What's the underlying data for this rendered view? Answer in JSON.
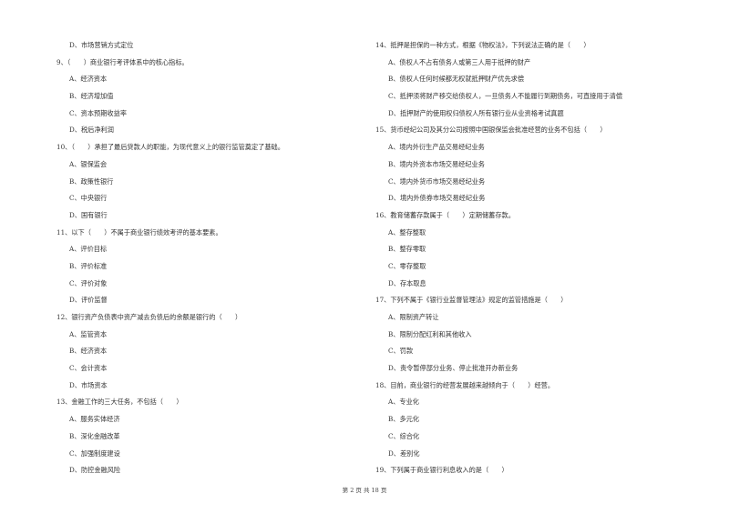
{
  "left_column": [
    {
      "type": "opt",
      "text": "D、市场营销方式定位"
    },
    {
      "type": "q",
      "text": "9、（　　）商业银行考评体系中的核心指标。"
    },
    {
      "type": "opt",
      "text": "A、经济资本"
    },
    {
      "type": "opt",
      "text": "B、经济增加值"
    },
    {
      "type": "opt",
      "text": "C、资本预期收益率"
    },
    {
      "type": "opt",
      "text": "D、税后净利润"
    },
    {
      "type": "q",
      "text": "10、（　　）承担了最后贷款人的职能，为现代意义上的银行监管奠定了基础。"
    },
    {
      "type": "opt",
      "text": "A、银保监会"
    },
    {
      "type": "opt",
      "text": "B、政策性银行"
    },
    {
      "type": "opt",
      "text": "C、中央银行"
    },
    {
      "type": "opt",
      "text": "D、国有银行"
    },
    {
      "type": "q",
      "text": "11、以下（　　）不属于商业银行绩效考评的基本要素。"
    },
    {
      "type": "opt",
      "text": "A、评价目标"
    },
    {
      "type": "opt",
      "text": "B、评价标准"
    },
    {
      "type": "opt",
      "text": "C、评价对象"
    },
    {
      "type": "opt",
      "text": "D、评价监督"
    },
    {
      "type": "q",
      "text": "12、银行资产负债表中资产减去负债后的余额是银行的（　　）"
    },
    {
      "type": "opt",
      "text": "A、监管资本"
    },
    {
      "type": "opt",
      "text": "B、经济资本"
    },
    {
      "type": "opt",
      "text": "C、会计资本"
    },
    {
      "type": "opt",
      "text": "D、市场资本"
    },
    {
      "type": "q",
      "text": "13、金融工作的三大任务，不包括（　　）"
    },
    {
      "type": "opt",
      "text": "A、服务实体经济"
    },
    {
      "type": "opt",
      "text": "B、深化金融改革"
    },
    {
      "type": "opt",
      "text": "C、加强制度建设"
    },
    {
      "type": "opt",
      "text": "D、防控金融风险"
    }
  ],
  "right_column": [
    {
      "type": "q",
      "text": "14、抵押是担保的一种方式，根据《物权法》，下列说法正确的是（　　）"
    },
    {
      "type": "opt",
      "text": "A、债权人不占有债务人或第三人用于抵押的财产"
    },
    {
      "type": "opt",
      "text": "B、债权人任何时候都无权就抵押财产优先求偿"
    },
    {
      "type": "opt",
      "text": "C、抵押须将财产移交给债权人，一旦债务人不能履行到期债务，可直接用于清偿"
    },
    {
      "type": "opt",
      "text": "D、抵押财产的使用权归债权人所有银行业从业资格考试真题"
    },
    {
      "type": "q",
      "text": "15、货币经纪公司及其分公司按照中国银保监会批准经营的业务不包括（　　）"
    },
    {
      "type": "opt",
      "text": "A、境内外衍生产品交易经纪业务"
    },
    {
      "type": "opt",
      "text": "B、境内外资本市场交易经纪业务"
    },
    {
      "type": "opt",
      "text": "C、境内外货币市场交易经纪业务"
    },
    {
      "type": "opt",
      "text": "D、境内外债券市场交易经纪业务"
    },
    {
      "type": "q",
      "text": "16、教育储蓄存款属于（　　）定期储蓄存款。"
    },
    {
      "type": "opt",
      "text": "A、整存整取"
    },
    {
      "type": "opt",
      "text": "B、整存零取"
    },
    {
      "type": "opt",
      "text": "C、零存整取"
    },
    {
      "type": "opt",
      "text": "D、存本取息"
    },
    {
      "type": "q",
      "text": "17、下列不属于《银行业监督管理法》规定的监管措施是（　　）"
    },
    {
      "type": "opt",
      "text": "A、限制资产转让"
    },
    {
      "type": "opt",
      "text": "B、限制分配红利和其他收入"
    },
    {
      "type": "opt",
      "text": "C、罚款"
    },
    {
      "type": "opt",
      "text": "D、责令暂停部分业务、停止批准开办新业务"
    },
    {
      "type": "q",
      "text": "18、目前，商业银行的经营发展越来越倾向于（　　）经营。"
    },
    {
      "type": "opt",
      "text": "A、专业化"
    },
    {
      "type": "opt",
      "text": "B、多元化"
    },
    {
      "type": "opt",
      "text": "C、综合化"
    },
    {
      "type": "opt",
      "text": "D、差别化"
    },
    {
      "type": "q",
      "text": "19、下列属于商业银行利息收入的是（　　）"
    }
  ],
  "footer": {
    "text": "第 2 页 共 18 页"
  }
}
